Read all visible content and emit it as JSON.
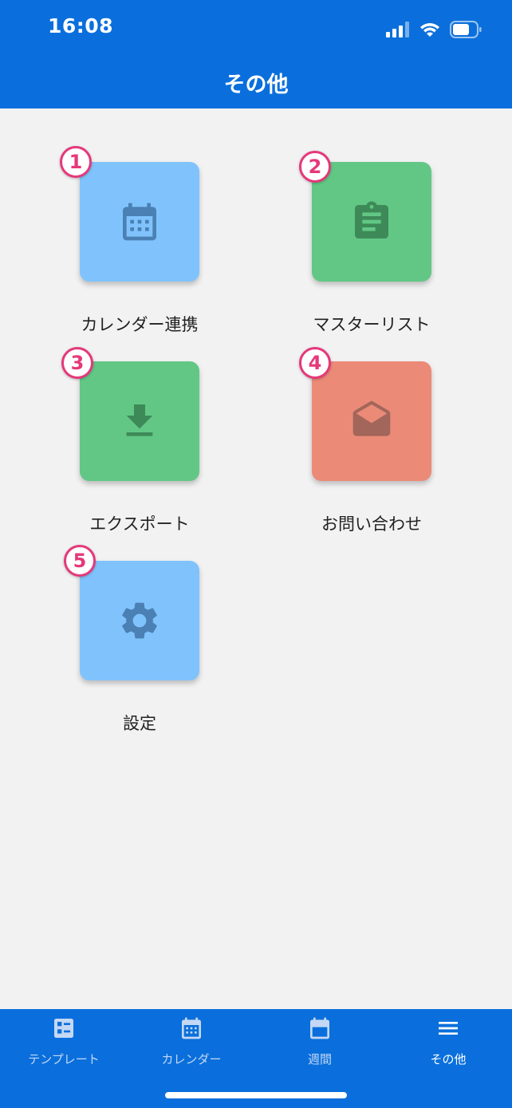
{
  "status_bar": {
    "time": "16:08"
  },
  "header": {
    "title": "その他"
  },
  "menu": [
    {
      "badge": "1",
      "label": "カレンダー連携",
      "icon": "calendar-icon",
      "color": "#80c3fc"
    },
    {
      "badge": "2",
      "label": "マスターリスト",
      "icon": "clipboard-icon",
      "color": "#62c785"
    },
    {
      "badge": "3",
      "label": "エクスポート",
      "icon": "download-icon",
      "color": "#62c785"
    },
    {
      "badge": "4",
      "label": "お問い合わせ",
      "icon": "mail-open-icon",
      "color": "#ec8a78"
    },
    {
      "badge": "5",
      "label": "設定",
      "icon": "gear-icon",
      "color": "#80c3fc"
    }
  ],
  "tabbar": {
    "items": [
      {
        "label": "テンプレート",
        "icon": "template-icon",
        "active": false
      },
      {
        "label": "カレンダー",
        "icon": "calendar-icon",
        "active": false
      },
      {
        "label": "週間",
        "icon": "week-icon",
        "active": false
      },
      {
        "label": "その他",
        "icon": "menu-icon",
        "active": true
      }
    ]
  },
  "colors": {
    "primary": "#0a6fdc",
    "badge": "#e5387a",
    "background": "#f2f2f2"
  }
}
